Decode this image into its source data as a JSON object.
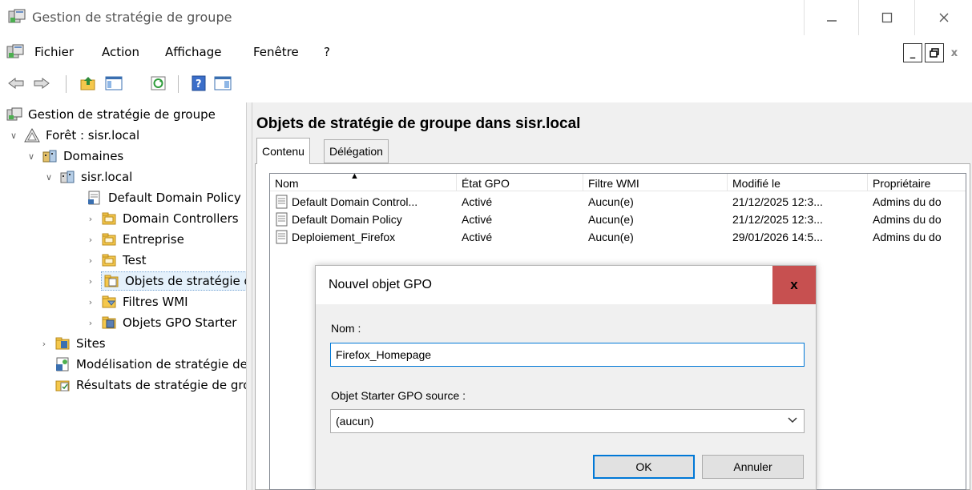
{
  "window": {
    "title": "Gestion de stratégie de groupe",
    "minimize_label": "—",
    "maximize_label": "☐",
    "close_label": "X"
  },
  "menubar": {
    "items": [
      "Fichier",
      "Action",
      "Affichage",
      "Fenêtre",
      "?"
    ],
    "mdi_minimize": "_",
    "mdi_restore": "🗗",
    "mdi_close": "x"
  },
  "toolbar": {
    "buttons": [
      "back-icon",
      "forward-icon",
      "up-folder-icon",
      "show-hide-tree-icon",
      "refresh-icon",
      "help-icon",
      "action-pane-icon"
    ]
  },
  "tree": {
    "items": [
      {
        "label": "Gestion de stratégie de groupe",
        "icon": "gpmc-icon",
        "toggle": ""
      },
      {
        "label": "Forêt : sisr.local",
        "icon": "forest-icon",
        "toggle": "∨"
      },
      {
        "label": "Domaines",
        "icon": "domains-icon",
        "toggle": "∨"
      },
      {
        "label": "sisr.local",
        "icon": "domain-icon",
        "toggle": "∨"
      },
      {
        "label": "Default Domain Policy",
        "icon": "gpo-link-icon",
        "toggle": ""
      },
      {
        "label": "Domain Controllers",
        "icon": "ou-icon",
        "toggle": "›"
      },
      {
        "label": "Entreprise",
        "icon": "ou-icon",
        "toggle": "›"
      },
      {
        "label": "Test",
        "icon": "ou-icon",
        "toggle": "›"
      },
      {
        "label": "Objets de stratégie de groupe",
        "icon": "gpo-folder-icon",
        "toggle": "›"
      },
      {
        "label": "Filtres WMI",
        "icon": "wmi-folder-icon",
        "toggle": "›"
      },
      {
        "label": "Objets GPO Starter",
        "icon": "starter-gpo-icon",
        "toggle": "›"
      },
      {
        "label": "Sites",
        "icon": "sites-icon",
        "toggle": "›"
      },
      {
        "label": "Modélisation de stratégie de groupe",
        "icon": "modeling-icon",
        "toggle": ""
      },
      {
        "label": "Résultats de stratégie de groupe",
        "icon": "results-icon",
        "toggle": ""
      }
    ]
  },
  "main": {
    "heading": "Objets de stratégie de groupe dans sisr.local",
    "tabs": [
      "Contenu",
      "Délégation"
    ],
    "columns": [
      "Nom",
      "État GPO",
      "Filtre WMI",
      "Modifié le",
      "Propriétaire"
    ],
    "rows": [
      {
        "name": "Default Domain Control...",
        "state": "Activé",
        "wmi": "Aucun(e)",
        "modified": "21/12/2025 12:3...",
        "owner": "Admins du do"
      },
      {
        "name": "Default Domain Policy",
        "state": "Activé",
        "wmi": "Aucun(e)",
        "modified": "21/12/2025 12:3...",
        "owner": "Admins du do"
      },
      {
        "name": "Deploiement_Firefox",
        "state": "Activé",
        "wmi": "Aucun(e)",
        "modified": "29/01/2026 14:5...",
        "owner": "Admins du do"
      }
    ]
  },
  "dialog": {
    "title": "Nouvel objet GPO",
    "close_label": "x",
    "name_label": "Nom :",
    "name_value": "Firefox_Homepage",
    "starter_label": "Objet Starter GPO source :",
    "starter_value": "(aucun)",
    "ok_label": "OK",
    "cancel_label": "Annuler"
  }
}
